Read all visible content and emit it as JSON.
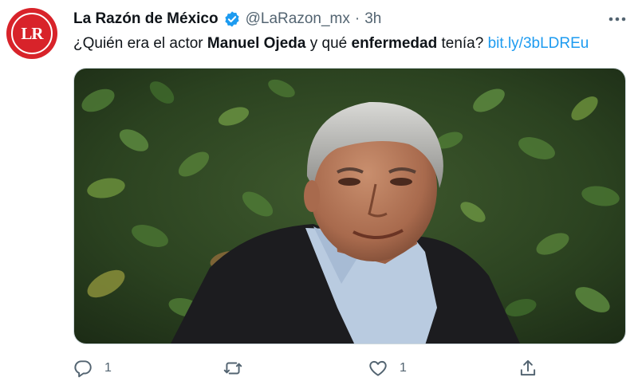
{
  "account": {
    "avatar_text": "LR",
    "name": "La Razón de México",
    "handle": "@LaRazon_mx",
    "separator": "·",
    "time": "3h"
  },
  "tweet": {
    "text_1": "¿Quién era el actor ",
    "bold_1": "Manuel Ojeda",
    "text_2": " y qué ",
    "bold_2": "enfermedad",
    "text_3": " tenía? ",
    "link": "bit.ly/3bLDREu"
  },
  "actions": {
    "reply_count": "1",
    "retweet_count": "",
    "like_count": "1"
  },
  "colors": {
    "brand_red": "#d8232a",
    "verified_blue": "#1d9bf0",
    "link_blue": "#1d9bf0",
    "secondary_text": "#536471"
  },
  "icons": [
    "verified-badge-icon",
    "more-icon",
    "reply-icon",
    "retweet-icon",
    "like-icon",
    "share-icon"
  ]
}
